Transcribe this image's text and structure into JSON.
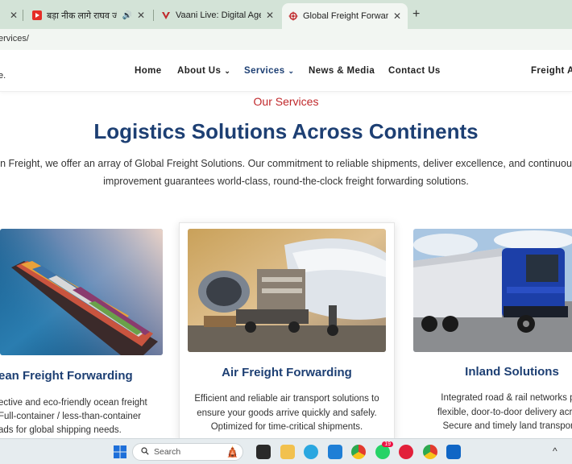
{
  "browser": {
    "tabs": [
      {
        "title": "बड़ा नीक लागे राघव जी के गा",
        "icon": "youtube-icon",
        "color": "#e52d27",
        "active": false
      },
      {
        "title": "Vaani Live: Digital Agency, Web",
        "icon": "vaani-icon",
        "color": "#c0282b",
        "active": false
      },
      {
        "title": "Global Freight Forwarding Servi",
        "icon": "ship-wheel-icon",
        "color": "#c0282b",
        "active": true
      }
    ],
    "new_tab_label": "+",
    "url": "ervices/"
  },
  "site": {
    "logo_fragment": "e.",
    "nav": [
      {
        "label": "Home",
        "dropdown": false,
        "active": false
      },
      {
        "label": "About Us",
        "dropdown": true,
        "active": false
      },
      {
        "label": "Services",
        "dropdown": true,
        "active": true
      },
      {
        "label": "News & Media",
        "dropdown": false,
        "active": false
      },
      {
        "label": "Contact Us",
        "dropdown": false,
        "active": false
      },
      {
        "label": "Freight Au",
        "dropdown": false,
        "active": false
      }
    ],
    "nav_chevron": "⌄",
    "subheading": "Our Services",
    "headline": "Logistics Solutions Across Continents",
    "intro_line1": "n Freight, we offer an array of Global Freight Solutions. Our commitment to reliable shipments, deliver excellence, and continuou",
    "intro_line2": "improvement guarantees world-class, round-the-clock freight forwarding solutions.",
    "cards": [
      {
        "title": "ean Freight Forwarding",
        "lines": [
          "ective and eco-friendly ocean freight",
          "Full-container / less-than-container",
          "ads for global shipping needs."
        ]
      },
      {
        "title": "Air Freight Forwarding",
        "lines": [
          "Efficient and reliable air transport solutions to",
          "ensure your goods arrive quickly and safely.",
          "Optimized for time-critical shipments."
        ]
      },
      {
        "title": "Inland Solutions",
        "lines": [
          "Integrated road & rail networks pro",
          "flexible, door-to-door delivery across",
          "Secure and timely land transporte"
        ]
      }
    ]
  },
  "taskbar": {
    "search_placeholder": "Search",
    "whatsapp_badge": "19",
    "colors": {
      "windows": "#1e6fd9",
      "chrome": "#e0a100",
      "vscode": "#1f7fd6",
      "whatsapp": "#25d366",
      "outlook": "#1066c5"
    },
    "tray_chevron": "^"
  },
  "colors": {
    "brand_navy": "#1d3f73",
    "brand_red": "#c0282b",
    "tabstrip": "#d3e3d7"
  }
}
